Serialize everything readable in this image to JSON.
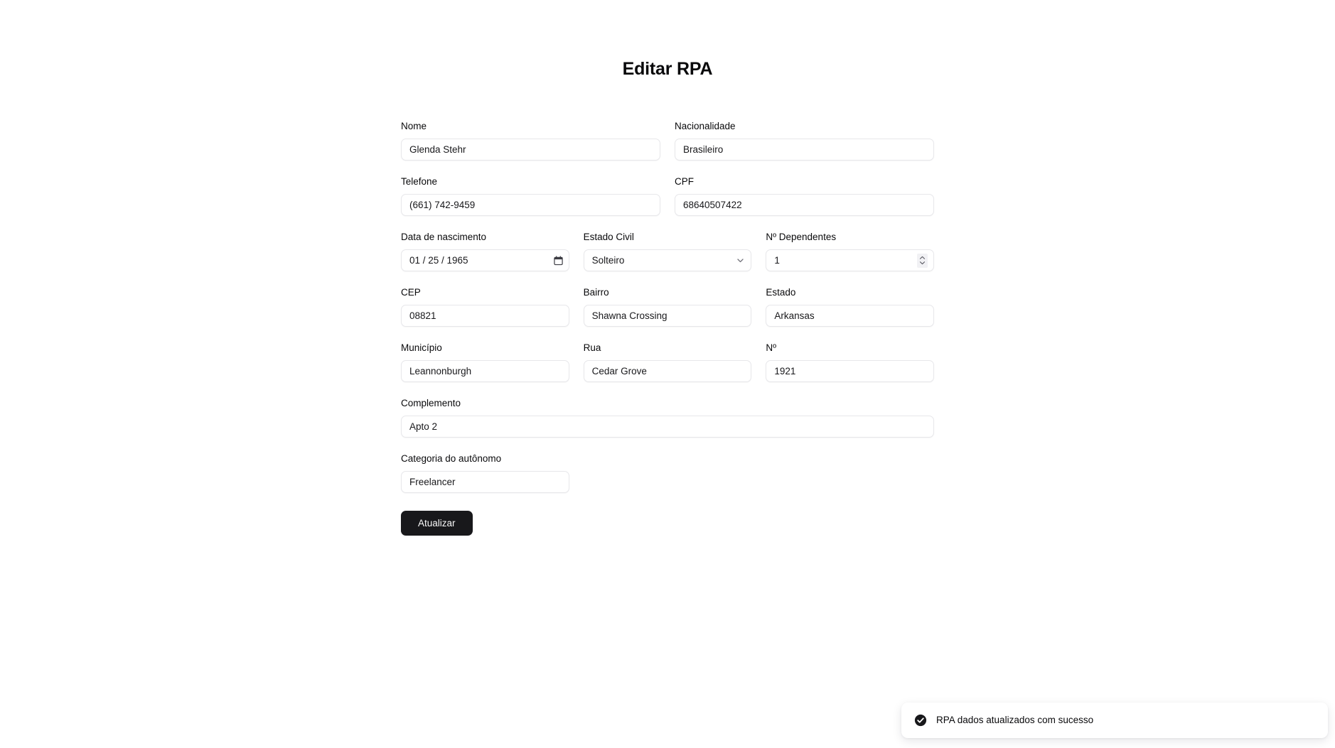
{
  "page": {
    "title": "Editar RPA"
  },
  "form": {
    "rows": [
      {
        "columns": 2,
        "fields": [
          {
            "label": "Nome",
            "value": "Glenda Stehr",
            "type": "text",
            "name": "nome"
          },
          {
            "label": "Nacionalidade",
            "value": "Brasileiro",
            "type": "text",
            "name": "nacionalidade"
          }
        ]
      },
      {
        "columns": 2,
        "fields": [
          {
            "label": "Telefone",
            "value": "(661) 742-9459",
            "type": "text",
            "name": "telefone"
          },
          {
            "label": "CPF",
            "value": "68640507422",
            "type": "text",
            "name": "cpf"
          }
        ]
      },
      {
        "columns": 3,
        "fields": [
          {
            "label": "Data de nascimento",
            "value": "01 / 25 / 1965",
            "type": "date",
            "name": "data-de-nascimento",
            "icon": "calendar-icon"
          },
          {
            "label": "Estado Civil",
            "value": "Solteiro",
            "type": "select",
            "name": "estado-civil",
            "icon": "chevron-down-icon"
          },
          {
            "label": "Nº Dependentes",
            "value": "1",
            "type": "number",
            "name": "numero-dependentes",
            "icon": "stepper-icon"
          }
        ]
      },
      {
        "columns": 3,
        "fields": [
          {
            "label": "CEP",
            "value": "08821",
            "type": "text",
            "name": "cep"
          },
          {
            "label": "Bairro",
            "value": "Shawna Crossing",
            "type": "text",
            "name": "bairro"
          },
          {
            "label": "Estado",
            "value": "Arkansas",
            "type": "text",
            "name": "estado"
          }
        ]
      },
      {
        "columns": 3,
        "fields": [
          {
            "label": "Município",
            "value": "Leannonburgh",
            "type": "text",
            "name": "municipio"
          },
          {
            "label": "Rua",
            "value": "Cedar Grove",
            "type": "text",
            "name": "rua"
          },
          {
            "label": "Nº",
            "value": "1921",
            "type": "text",
            "name": "numero"
          }
        ]
      },
      {
        "columns": 1,
        "fields": [
          {
            "label": "Complemento",
            "value": "Apto 2",
            "type": "text",
            "name": "complemento"
          }
        ]
      },
      {
        "columns": 3,
        "fields": [
          {
            "label": "Categoria do autônomo",
            "value": "Freelancer",
            "type": "text",
            "name": "categoria-do-autonomo"
          }
        ]
      }
    ],
    "submit_label": "Atualizar"
  },
  "toast": {
    "message": "RPA dados atualizados com sucesso",
    "icon": "check-circle-icon",
    "icon_color": "#18181b"
  },
  "colors": {
    "page_background": "#ffffff",
    "text": "#09090b",
    "input_border": "#e7e7ea",
    "button_background": "#18181b",
    "button_text": "#fafafa"
  }
}
